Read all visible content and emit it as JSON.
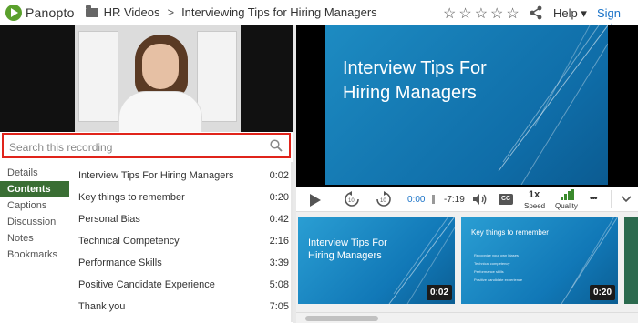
{
  "header": {
    "brand": "Panopto",
    "breadcrumb_folder": "HR Videos",
    "breadcrumb_sep": ">",
    "title": "Interviewing Tips for Hiring Managers",
    "rating_stars": "☆☆☆☆☆",
    "help_label": "Help ▾",
    "signout_label": "Sign out"
  },
  "search": {
    "placeholder": "Search this recording"
  },
  "sidenav": {
    "items": [
      {
        "label": "Details",
        "active": false
      },
      {
        "label": "Contents",
        "active": true
      },
      {
        "label": "Captions",
        "active": false
      },
      {
        "label": "Discussion",
        "active": false
      },
      {
        "label": "Notes",
        "active": false
      },
      {
        "label": "Bookmarks",
        "active": false
      }
    ]
  },
  "contents": {
    "rows": [
      {
        "title": "Interview Tips For Hiring Managers",
        "time": "0:02"
      },
      {
        "title": "Key things to remember",
        "time": "0:20"
      },
      {
        "title": "Personal Bias",
        "time": "0:42"
      },
      {
        "title": "Technical Competency",
        "time": "2:16"
      },
      {
        "title": "Performance Skills",
        "time": "3:39"
      },
      {
        "title": "Positive Candidate Experience",
        "time": "5:08"
      },
      {
        "title": "Thank you",
        "time": "7:05"
      }
    ]
  },
  "slide": {
    "title_line1": "Interview Tips For",
    "title_line2": "Hiring Managers"
  },
  "controls": {
    "elapsed": "0:00",
    "remaining": "-7:19",
    "cc": "CC",
    "speed_value": "1x",
    "speed_label": "Speed",
    "quality_label": "Quality",
    "more": "•••",
    "skip_back": "10",
    "skip_fwd": "10"
  },
  "thumbnails": [
    {
      "title_line1": "Interview Tips For",
      "title_line2": "Hiring Managers",
      "time": "0:02"
    },
    {
      "title": "Key things to remember",
      "bullets": [
        "Recognize your own biases",
        "Technical competency",
        "Performance skills",
        "Positive candidate experience"
      ],
      "time": "0:20"
    }
  ],
  "colors": {
    "brand_green": "#5aa02c",
    "active_nav": "#3a6e34",
    "search_border": "#e0241b",
    "link_blue": "#1a73c8",
    "slide_blue": "#0f6da8"
  }
}
